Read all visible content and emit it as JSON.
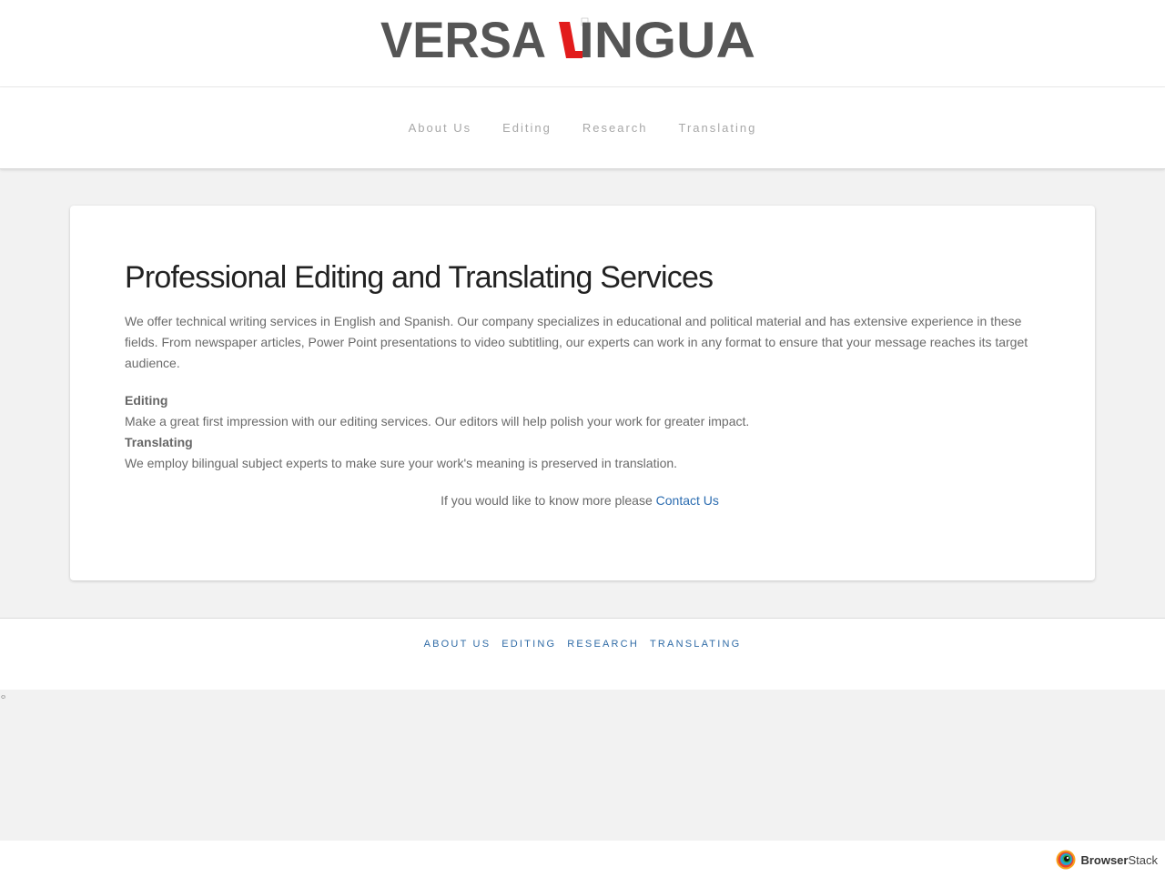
{
  "logo": {
    "text_left": "VERSA",
    "text_right": "INGUA",
    "accent_color": "#e21b1b",
    "text_color": "#555555"
  },
  "nav": {
    "items": [
      {
        "label": "About Us"
      },
      {
        "label": "Editing"
      },
      {
        "label": "Research"
      },
      {
        "label": "Translating"
      }
    ]
  },
  "main": {
    "headline": "Professional Editing and Translating Services",
    "intro": "We offer technical writing services in English and Spanish. Our company specializes in educational and political material and has extensive experience in these fields. From newspaper articles, Power Point presentations to video subtitling, our experts can work in any format to ensure that your message reaches its target audience.",
    "services": [
      {
        "title": "Editing",
        "description": "Make a great first impression with our editing services. Our editors will help polish your work for greater impact."
      },
      {
        "title": "Translating",
        "description": "We employ bilingual subject experts to make sure your work's meaning is preserved in translation."
      }
    ],
    "contact_prefix": "If you would like to know more please",
    "contact_link": "Contact Us"
  },
  "footer": {
    "items": [
      {
        "label": "ABOUT US"
      },
      {
        "label": "EDITING"
      },
      {
        "label": "RESEARCH"
      },
      {
        "label": "TRANSLATING"
      }
    ]
  },
  "badge": {
    "brand_left": "Browser",
    "brand_right": "Stack",
    "icon": "browserstack-logo-icon"
  },
  "colors": {
    "link": "#2b6cb0",
    "footer_link": "#2f6ba6",
    "background": "#f2f2f2"
  }
}
